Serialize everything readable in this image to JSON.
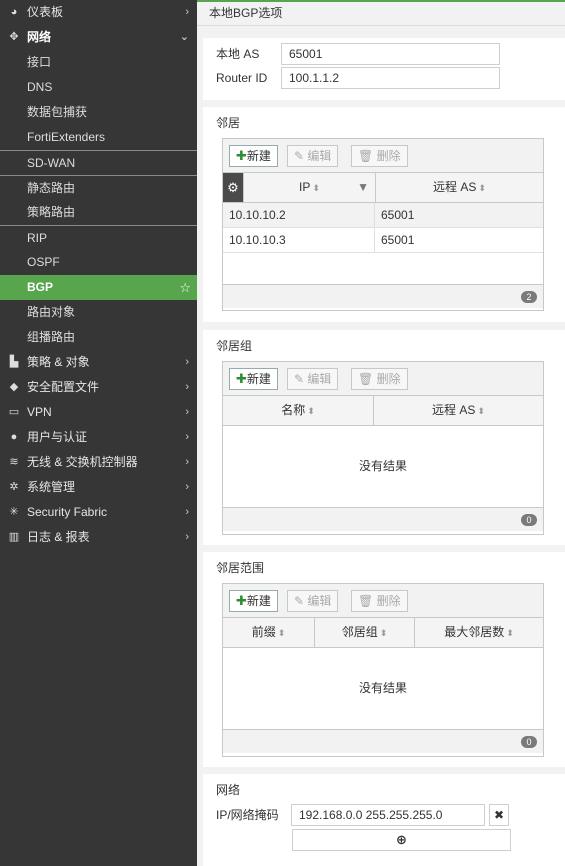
{
  "sidebar": {
    "top": [
      {
        "icon": "dashboard-icon",
        "glyph": "◕",
        "label": "仪表板",
        "chevron": "›"
      }
    ],
    "network": {
      "icon": "network-icon",
      "glyph": "✥",
      "label": "网络",
      "chevron": "⌄"
    },
    "network_items": [
      "接口",
      "DNS",
      "数据包捕获",
      "FortiExtenders",
      "SD-WAN",
      "静态路由",
      "策略路由",
      "RIP",
      "OSPF",
      "BGP",
      "路由对象",
      "组播路由"
    ],
    "active_item": "BGP",
    "star_glyph": "☆",
    "bottom": [
      {
        "name": "policy",
        "icon": "policy-icon",
        "glyph": "▙",
        "label": "策略 & 对象"
      },
      {
        "name": "security",
        "icon": "shield-icon",
        "glyph": "◆",
        "label": "安全配置文件"
      },
      {
        "name": "vpn",
        "icon": "monitor-icon",
        "glyph": "▭",
        "label": "VPN"
      },
      {
        "name": "user",
        "icon": "user-icon",
        "glyph": "●",
        "label": "用户与认证"
      },
      {
        "name": "wifi",
        "icon": "wifi-icon",
        "glyph": "≋",
        "label": "无线 & 交换机控制器"
      },
      {
        "name": "system",
        "icon": "gear-icon",
        "glyph": "✲",
        "label": "系统管理"
      },
      {
        "name": "fabric",
        "icon": "fabric-icon",
        "glyph": "✳",
        "label": "Security Fabric"
      },
      {
        "name": "log",
        "icon": "chart-icon",
        "glyph": "▥",
        "label": "日志 & 报表"
      }
    ]
  },
  "main": {
    "page_title": "本地BGP选项",
    "local_as_label": "本地 AS",
    "local_as_value": "65001",
    "router_id_label": "Router ID",
    "router_id_value": "100.1.1.2",
    "new_label": "新建",
    "edit_label": "编辑",
    "delete_label": "删除",
    "neighbors": {
      "title": "邻居",
      "col_ip": "IP",
      "col_remote_as": "远程 AS",
      "rows": [
        {
          "ip": "10.10.10.2",
          "remote_as": "65001"
        },
        {
          "ip": "10.10.10.3",
          "remote_as": "65001"
        }
      ],
      "count": "2"
    },
    "neighbor_groups": {
      "title": "邻居组",
      "col_name": "名称",
      "col_remote_as": "远程 AS",
      "empty": "没有结果",
      "count": "0"
    },
    "neighbor_ranges": {
      "title": "邻居范围",
      "col_prefix": "前缀",
      "col_group": "邻居组",
      "col_max": "最大邻居数",
      "empty": "没有结果",
      "count": "0"
    },
    "networks": {
      "title": "网络",
      "label": "IP/网络掩码",
      "value": "192.168.0.0 255.255.255.0"
    }
  },
  "colors": {
    "accent": "#57a64d",
    "sidebar_bg": "#363636"
  }
}
